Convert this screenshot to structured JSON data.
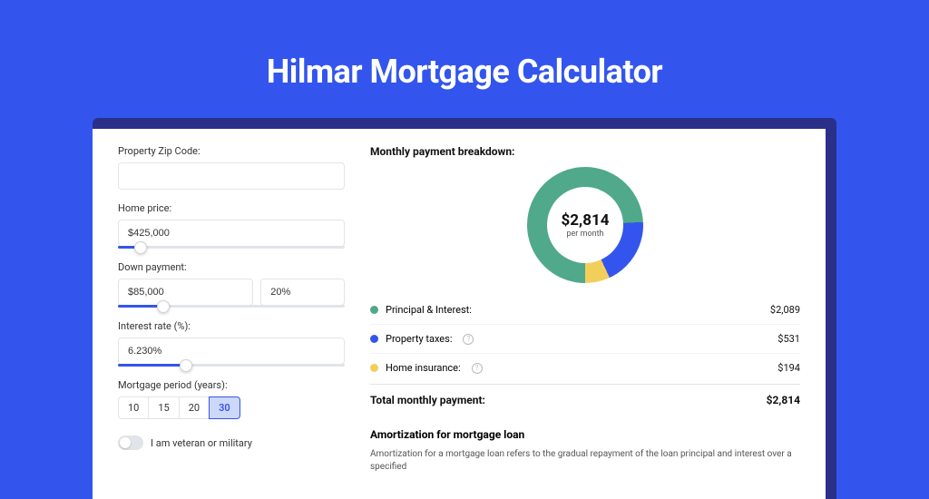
{
  "hero": {
    "title": "Hilmar Mortgage Calculator"
  },
  "form": {
    "zip": {
      "label": "Property Zip Code:",
      "value": ""
    },
    "home_price": {
      "label": "Home price:",
      "value": "$425,000",
      "slider_pct": 10
    },
    "down_payment": {
      "label": "Down payment:",
      "amount": "$85,000",
      "percent": "20%",
      "slider_pct": 20
    },
    "interest": {
      "label": "Interest rate (%):",
      "value": "6.230%",
      "slider_pct": 30
    },
    "period": {
      "label": "Mortgage period (years):",
      "options": [
        "10",
        "15",
        "20",
        "30"
      ],
      "selected": "30"
    },
    "veteran": {
      "label": "I am veteran or military",
      "on": false
    }
  },
  "breakdown": {
    "title": "Monthly payment breakdown:",
    "donut": {
      "value": "$2,814",
      "sub": "per month"
    },
    "items": [
      {
        "label": "Principal & Interest:",
        "value": "$2,089",
        "color": "#4fa98a",
        "fraction": 0.742,
        "help": false
      },
      {
        "label": "Property taxes:",
        "value": "$531",
        "color": "#3355ee",
        "fraction": 0.189,
        "help": true
      },
      {
        "label": "Home insurance:",
        "value": "$194",
        "color": "#f2cf5b",
        "fraction": 0.069,
        "help": true
      }
    ],
    "total": {
      "label": "Total monthly payment:",
      "value": "$2,814"
    }
  },
  "amortization": {
    "title": "Amortization for mortgage loan",
    "text": "Amortization for a mortgage loan refers to the gradual repayment of the loan principal and interest over a specified"
  },
  "chart_data": {
    "type": "pie",
    "title": "Monthly payment breakdown",
    "categories": [
      "Principal & Interest",
      "Property taxes",
      "Home insurance"
    ],
    "values": [
      2089,
      531,
      194
    ],
    "colors": [
      "#4fa98a",
      "#3355ee",
      "#f2cf5b"
    ],
    "total": 2814,
    "center_label": "$2,814 per month"
  }
}
